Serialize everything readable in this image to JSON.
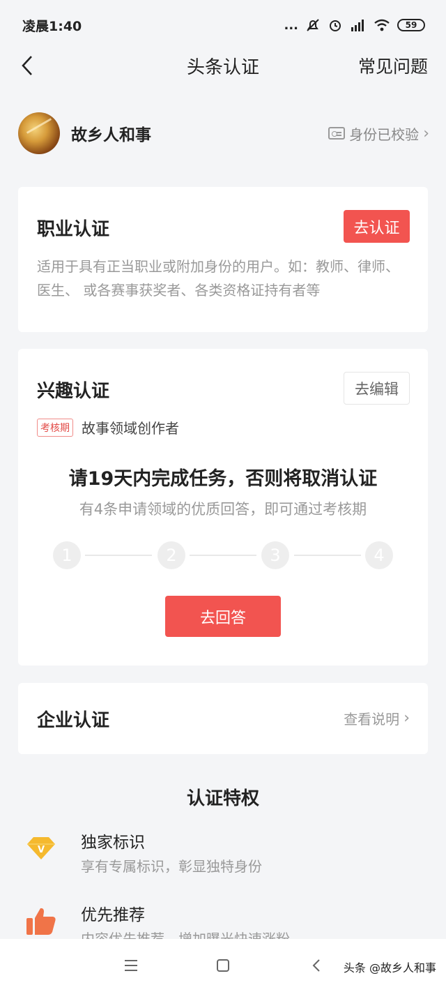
{
  "status_bar": {
    "time": "凌晨1:40",
    "dots": "...",
    "battery": "59"
  },
  "nav": {
    "title": "头条认证",
    "faq": "常见问题"
  },
  "user": {
    "name": "故乡人和事",
    "verify_status": "身份已校验"
  },
  "professional": {
    "title": "职业认证",
    "button": "去认证",
    "description": "适用于具有正当职业或附加身份的用户。如：教师、律师、医生、 或各赛事获奖者、各类资格证持有者等"
  },
  "interest": {
    "title": "兴趣认证",
    "button": "去编辑",
    "tag": "考核期",
    "field": "故事领域创作者",
    "warning": "请19天内完成任务，否则将取消认证",
    "hint": "有4条申请领域的优质回答，即可通过考核期",
    "steps": [
      "1",
      "2",
      "3",
      "4"
    ],
    "completed_steps": 0,
    "answer_button": "去回答"
  },
  "enterprise": {
    "title": "企业认证",
    "link": "查看说明"
  },
  "privileges": {
    "heading": "认证特权",
    "items": [
      {
        "title": "独家标识",
        "desc": "享有专属标识，彰显独特身份",
        "icon": "diamond-badge-icon",
        "color": "#f5b92e"
      },
      {
        "title": "优先推荐",
        "desc": "内容优先推荐，增加曝光快速涨粉",
        "icon": "thumbs-up-icon",
        "color": "#f07448"
      }
    ]
  },
  "watermark": "头条 @故乡人和事",
  "colors": {
    "accent": "#f25450",
    "background": "#f4f5f7"
  }
}
